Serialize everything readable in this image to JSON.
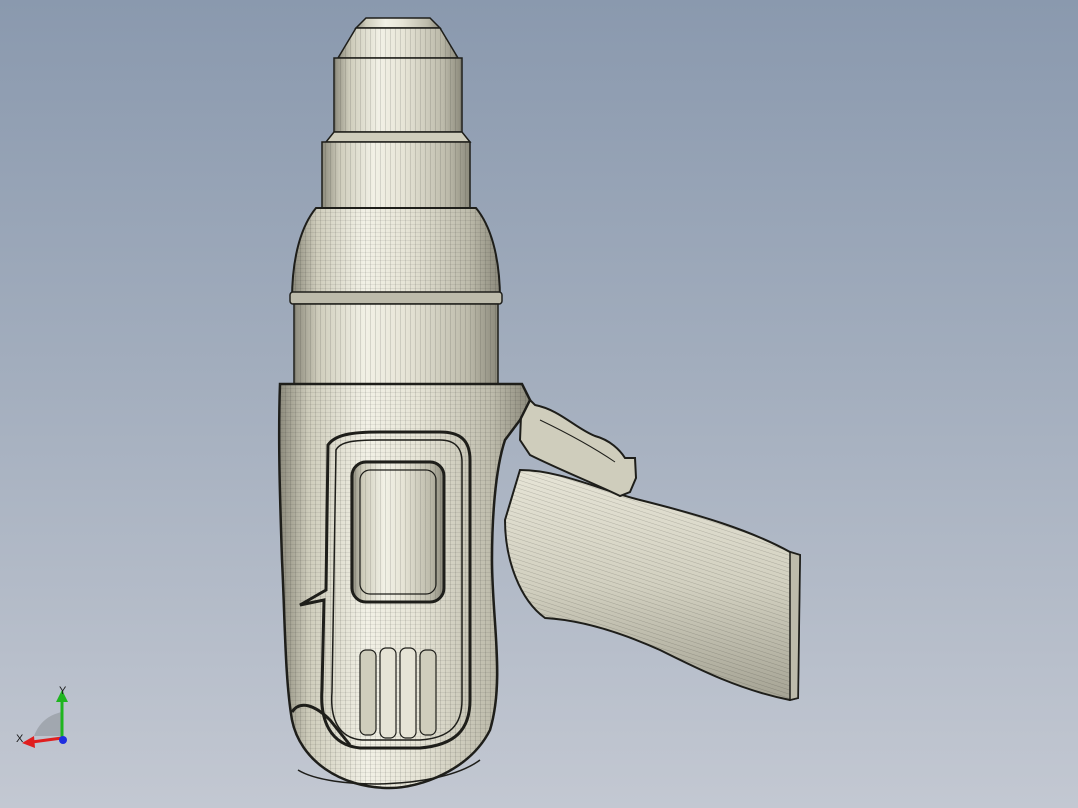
{
  "viewport": {
    "background_top": "#8a99ae",
    "background_bottom": "#c3c8d2"
  },
  "model": {
    "shading_color": "#dcdac8",
    "highlight_color": "#f2f1e6",
    "shadow_color": "#8c8a7c",
    "edge_color": "#1e1e1a"
  },
  "triad": {
    "x_label": "X",
    "y_label": "Y",
    "x_color": "#e01e1e",
    "y_color": "#1fb51f",
    "z_color": "#1e2ee0"
  }
}
